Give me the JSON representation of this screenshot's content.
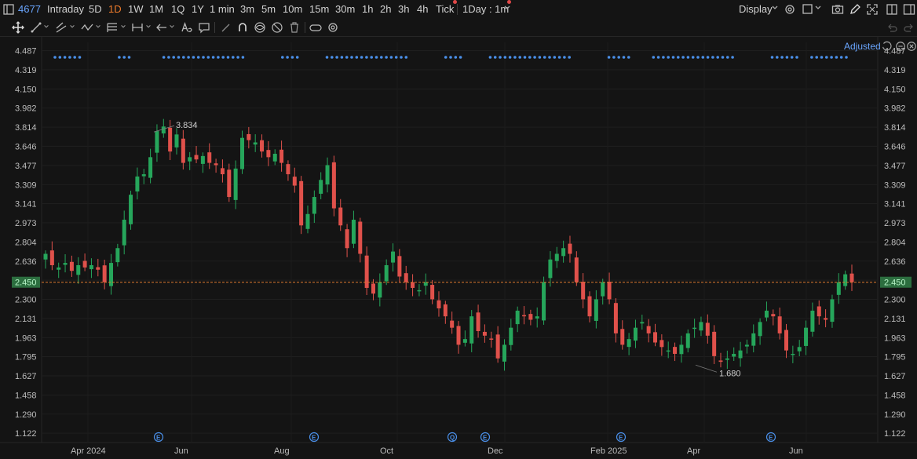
{
  "topbar": {
    "symbol": "4677",
    "intervals": [
      "Intraday",
      "5D",
      "1D",
      "1W",
      "1M",
      "1Q",
      "1Y",
      "1 min",
      "3m",
      "5m",
      "10m",
      "15m",
      "30m",
      "1h",
      "2h",
      "3h",
      "4h",
      "Tick"
    ],
    "active_interval": "1D",
    "interval_combo": "1Day : 1m",
    "display_label": "Display"
  },
  "chart_overlay": {
    "adjusted_label": "Adjusted"
  },
  "chart_data": {
    "type": "candlestick",
    "title": "",
    "y_ticks": [
      "4.487",
      "4.319",
      "4.150",
      "3.982",
      "3.814",
      "3.646",
      "3.477",
      "3.309",
      "3.141",
      "2.973",
      "2.804",
      "2.636",
      "2.468",
      "2.300",
      "2.131",
      "1.963",
      "1.795",
      "1.627",
      "1.458",
      "1.290",
      "1.122"
    ],
    "y_range": [
      1.04,
      4.56
    ],
    "x_labels": [
      "Apr 2024",
      "Jun",
      "Aug",
      "Oct",
      "Dec",
      "Feb 2025",
      "Apr",
      "Jun"
    ],
    "current_price": "2.450",
    "high_annotation": "3.834",
    "low_annotation": "1.680",
    "event_markers": [
      "E",
      "E",
      "Q",
      "E",
      "E",
      "E"
    ],
    "up_color": "#26a65b",
    "down_color": "#e0514b",
    "price_line_color": "#e07a2e",
    "closes": [
      2.7,
      2.6,
      2.58,
      2.62,
      2.55,
      2.6,
      2.58,
      2.6,
      2.56,
      2.45,
      2.62,
      2.75,
      3.0,
      3.22,
      3.38,
      3.4,
      3.55,
      3.78,
      3.82,
      3.6,
      3.75,
      3.5,
      3.55,
      3.53,
      3.56,
      3.5,
      3.48,
      3.4,
      3.2,
      3.45,
      3.72,
      3.7,
      3.68,
      3.6,
      3.55,
      3.58,
      3.5,
      3.4,
      3.3,
      2.95,
      3.05,
      3.2,
      3.35,
      3.48,
      3.1,
      2.95,
      2.75,
      3.0,
      2.7,
      2.4,
      2.35,
      2.45,
      2.6,
      2.72,
      2.5,
      2.45,
      2.4,
      2.38,
      2.45,
      2.3,
      2.22,
      2.15,
      2.05,
      1.9,
      1.95,
      2.15,
      2.02,
      1.98,
      1.95,
      1.78,
      1.9,
      2.05,
      2.2,
      2.15,
      2.12,
      2.15,
      2.45,
      2.65,
      2.7,
      2.75,
      2.7,
      2.45,
      2.3,
      2.15,
      2.3,
      2.45,
      2.3,
      2.0,
      1.9,
      1.95,
      2.05,
      2.1,
      2.0,
      1.92,
      1.88,
      1.85,
      1.82,
      1.9,
      2.0,
      2.05,
      2.1,
      1.98,
      1.8,
      1.75,
      1.78,
      1.82,
      1.85,
      1.9,
      2.0,
      2.1,
      2.2,
      2.15,
      2.0,
      1.85,
      1.82,
      1.88,
      2.05,
      2.2,
      2.15,
      2.12,
      2.3,
      2.45,
      2.52,
      2.45
    ]
  }
}
